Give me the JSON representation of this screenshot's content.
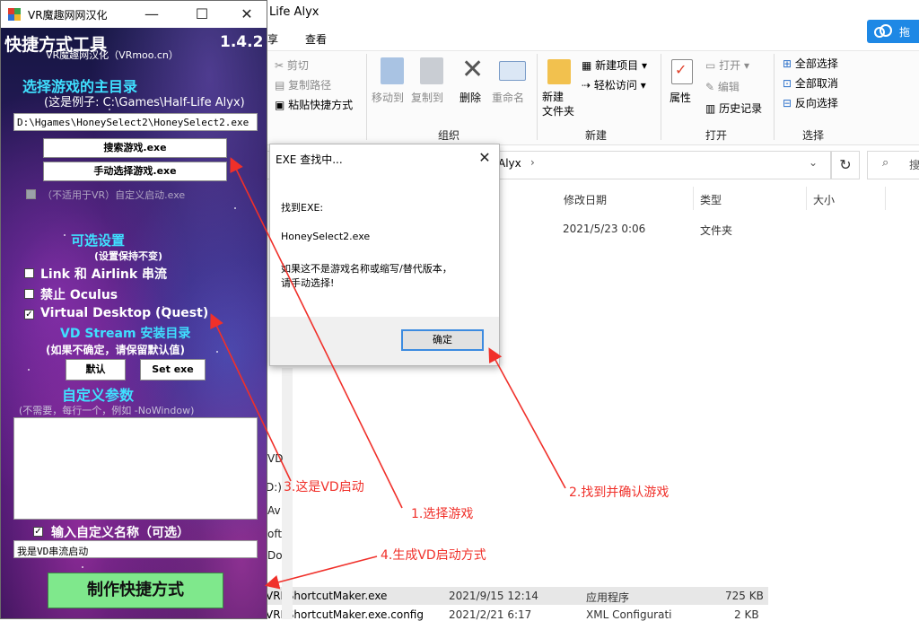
{
  "explorer": {
    "title": "Life Alyx",
    "cloud_label": "拖",
    "menu": [
      "享",
      "查看"
    ],
    "clipboard": {
      "cut": "剪切",
      "copy_path": "复制路径",
      "paste_shortcut": "粘贴快捷方式",
      "group": ""
    },
    "organize": {
      "move_to": "移动到",
      "copy_to": "复制到",
      "delete": "删除",
      "rename": "重命名",
      "group": "组织"
    },
    "new": {
      "new_folder": "新建\n文件夹",
      "new_item": "新建项目",
      "easy_access": "轻松访问",
      "group": "新建"
    },
    "open": {
      "properties": "属性",
      "open": "打开",
      "edit": "编辑",
      "history": "历史记录",
      "group": "打开"
    },
    "select": {
      "select_all": "全部选择",
      "select_none": "全部取消",
      "invert": "反向选择",
      "group": "选择"
    },
    "address": "Alyx",
    "search_placeholder": "搜",
    "columns": [
      "修改日期",
      "类型",
      "大小"
    ],
    "rows": [
      {
        "name": "",
        "date": "2021/5/23 0:06",
        "type": "文件夹",
        "size": ""
      },
      {
        "name": "VRPShortcutMaker.exe",
        "date": "2021/9/15 12:14",
        "type": "应用程序",
        "size": "725 KB"
      },
      {
        "name": "VRPShortcutMaker.exe.config",
        "date": "2021/2/21 6:17",
        "type": "XML Configurati",
        "size": "2 KB"
      }
    ],
    "nav_fragments": [
      "VD",
      "D:)",
      "Av",
      "oft",
      "Do"
    ]
  },
  "tool": {
    "title": "VR魔趣网网汉化",
    "app_name": "快捷方式工具",
    "version": "1.4.2",
    "subtitle": "VR魔趣网汉化（VRmoo.cn）",
    "select_dir_label": "选择游戏的主目录",
    "example_text": "(这是例子: C:\\Games\\Half-Life Alyx)",
    "path_value": "D:\\Hgames\\HoneySelect2\\HoneySelect2.exe",
    "search_exe_button": "搜索游戏.exe",
    "manual_exe_button": "手动选择游戏.exe",
    "custom_launch_label": "（不适用于VR）自定义启动.exe",
    "options_title": "可选设置",
    "options_hint": "(设置保持不变)",
    "options": [
      {
        "label": "Link 和 Airlink 串流",
        "checked": false
      },
      {
        "label": "禁止 Oculus",
        "checked": false
      },
      {
        "label": "Virtual Desktop (Quest)",
        "checked": true
      }
    ],
    "vd_dir_title": "VD Stream 安装目录",
    "vd_dir_hint": "(如果不确定，请保留默认值)",
    "default_button": "默认",
    "set_exe_button": "Set exe",
    "custom_params_title": "自定义参数",
    "custom_params_hint": "(不需要，每行一个，例如 -NoWindow)",
    "custom_params_value": "",
    "custom_name_label": "输入自定义名称（可选）",
    "custom_name_checked": true,
    "custom_name_value": "我是VD串流启动",
    "make_button": "制作快捷方式"
  },
  "dialog": {
    "title": "EXE 查找中...",
    "found_label": "找到EXE:",
    "exe_name": "HoneySelect2.exe",
    "warning_line1": "如果这不是游戏名称或缩写/替代版本，",
    "warning_line2": "请手动选择!",
    "ok_button": "确定"
  },
  "annotations": {
    "a1": "1.选择游戏",
    "a2": "2.找到并确认游戏",
    "a3": "3.这是VD启动",
    "a4": "4.生成VD启动方式",
    "color": "#f0302a"
  }
}
